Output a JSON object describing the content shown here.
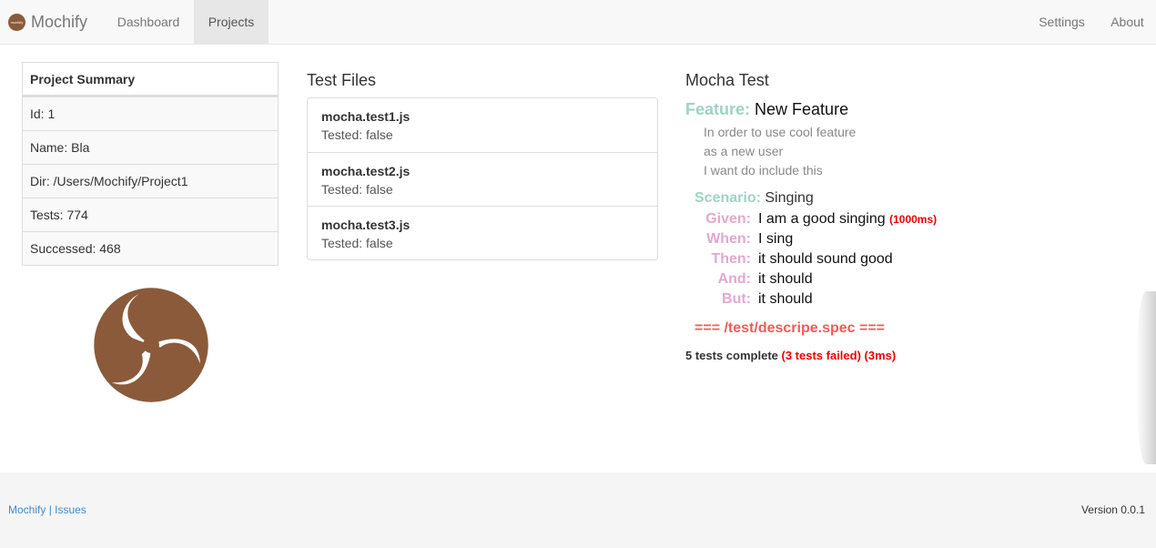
{
  "brand": {
    "logo_text": "mochify",
    "name": "Mochify",
    "logo_color": "#8a5a3a"
  },
  "nav": {
    "dashboard": "Dashboard",
    "projects": "Projects",
    "settings": "Settings",
    "about": "About"
  },
  "summary": {
    "title": "Project Summary",
    "rows": [
      "Id: 1",
      "Name: Bla",
      "Dir: /Users/Mochify/Project1",
      "Tests: 774",
      "Successed: 468"
    ]
  },
  "test_files": {
    "title": "Test Files",
    "files": [
      {
        "name": "mocha.test1.js",
        "status": "Tested: false"
      },
      {
        "name": "mocha.test2.js",
        "status": "Tested: false"
      },
      {
        "name": "mocha.test3.js",
        "status": "Tested: false"
      }
    ]
  },
  "mocha": {
    "title": "Mocha Test",
    "feature_kw": "Feature:",
    "feature_name": "New Feature",
    "narrative": [
      "In order to use cool feature",
      "as a new user",
      "I want do include this"
    ],
    "scenario_kw": "Scenario:",
    "scenario_name": "Singing",
    "steps": [
      {
        "kw": "Given:",
        "text": "I am a good singing",
        "time": "(1000ms)"
      },
      {
        "kw": "When:",
        "text": "I sing",
        "time": ""
      },
      {
        "kw": "Then:",
        "text": "it should sound good",
        "time": ""
      },
      {
        "kw": "And:",
        "text": "it should",
        "time": ""
      },
      {
        "kw": "But:",
        "text": "it should",
        "time": ""
      }
    ],
    "spec": "=== /test/descripe.spec ===",
    "result_complete": "5 tests complete",
    "result_failed": "(3 tests failed)",
    "result_time": "(3ms)"
  },
  "footer": {
    "link_mochify": "Mochify",
    "separator": "|",
    "link_issues": "Issues",
    "version": "Version 0.0.1"
  }
}
